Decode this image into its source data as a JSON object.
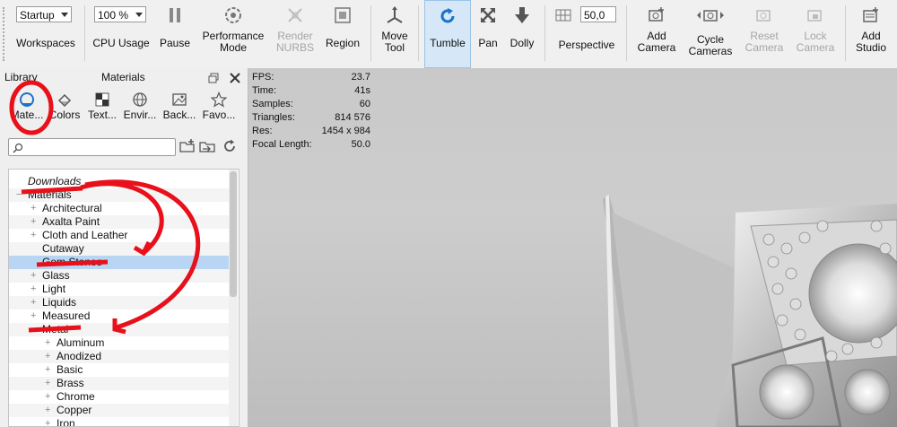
{
  "toolbar": {
    "workspace_combo": "Startup",
    "workspaces_label": "Workspaces",
    "cpu_combo": "100 %",
    "cpu_label": "CPU Usage",
    "pause_label": "Pause",
    "performance_label_1": "Performance",
    "performance_label_2": "Mode",
    "render_label_1": "Render",
    "render_label_2": "NURBS",
    "region_label": "Region",
    "move_label_1": "Move",
    "move_label_2": "Tool",
    "tumble_label": "Tumble",
    "pan_label": "Pan",
    "dolly_label": "Dolly",
    "focal_value": "50,0",
    "perspective_label": "Perspective",
    "add_camera_1": "Add",
    "add_camera_2": "Camera",
    "cycle_1": "Cycle",
    "cycle_2": "Cameras",
    "reset_1": "Reset",
    "reset_2": "Camera",
    "lock_1": "Lock",
    "lock_2": "Camera",
    "add_studio_1": "Add",
    "add_studio_2": "Studio"
  },
  "library": {
    "title": "Library",
    "panel_label": "Materials",
    "tabs": [
      {
        "label": "Mate...",
        "icon": "material-sphere-icon"
      },
      {
        "label": "Colors",
        "icon": "paint-bucket-icon"
      },
      {
        "label": "Text...",
        "icon": "texture-checker-icon"
      },
      {
        "label": "Envir...",
        "icon": "globe-icon"
      },
      {
        "label": "Back...",
        "icon": "image-icon"
      },
      {
        "label": "Favo...",
        "icon": "star-icon"
      }
    ],
    "search_placeholder": "",
    "tree": [
      {
        "label": "Downloads",
        "level": 0,
        "expander": "",
        "italic": true
      },
      {
        "label": "Materials",
        "level": 0,
        "expander": "−",
        "italic": false
      },
      {
        "label": "Architectural",
        "level": 1,
        "expander": "+"
      },
      {
        "label": "Axalta Paint",
        "level": 1,
        "expander": "+"
      },
      {
        "label": "Cloth and Leather",
        "level": 1,
        "expander": "+"
      },
      {
        "label": "Cutaway",
        "level": 1,
        "expander": ""
      },
      {
        "label": "Gem Stones",
        "level": 1,
        "expander": "",
        "selected": true
      },
      {
        "label": "Glass",
        "level": 1,
        "expander": "+"
      },
      {
        "label": "Light",
        "level": 1,
        "expander": "+"
      },
      {
        "label": "Liquids",
        "level": 1,
        "expander": "+"
      },
      {
        "label": "Measured",
        "level": 1,
        "expander": "+"
      },
      {
        "label": "Metal",
        "level": 1,
        "expander": "−"
      },
      {
        "label": "Aluminum",
        "level": 2,
        "expander": "+"
      },
      {
        "label": "Anodized",
        "level": 2,
        "expander": "+"
      },
      {
        "label": "Basic",
        "level": 2,
        "expander": "+"
      },
      {
        "label": "Brass",
        "level": 2,
        "expander": "+"
      },
      {
        "label": "Chrome",
        "level": 2,
        "expander": "+"
      },
      {
        "label": "Copper",
        "level": 2,
        "expander": "+"
      },
      {
        "label": "Iron",
        "level": 2,
        "expander": "+"
      }
    ]
  },
  "stats": [
    {
      "key": "FPS:",
      "value": "23.7"
    },
    {
      "key": "Time:",
      "value": "41s"
    },
    {
      "key": "Samples:",
      "value": "60"
    },
    {
      "key": "Triangles:",
      "value": "814 576"
    },
    {
      "key": "Res:",
      "value": "1454 x 984"
    },
    {
      "key": "Focal Length:",
      "value": "50.0"
    }
  ],
  "colors": {
    "annotation_red": "#e8101a",
    "selection_blue": "#b8d6f3",
    "active_tool": "#d6e7f7",
    "accent_blue": "#1a73c8"
  }
}
